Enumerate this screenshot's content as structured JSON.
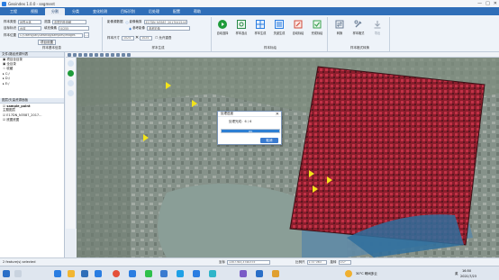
{
  "window": {
    "title": "Geoindex 1.0.0 - segment",
    "min": "—",
    "max": "□",
    "close": "✕"
  },
  "menu": {
    "tabs": [
      "工程",
      "视图",
      "分割",
      "分类",
      "变化检测",
      "目标识别",
      "后处理",
      "配置",
      "帮助"
    ],
    "active_index": 2
  },
  "ribbon": {
    "params": {
      "sample_type_label": "样本类型",
      "sample_type_value": "地表水体",
      "target_label": "目标标识",
      "target_value": "水体",
      "sample_pos_label": "样本位置",
      "sample_pos_value": "C:/Users/pan/Desktop/samples/images",
      "range_label": "范围",
      "range_value": "金属阳极电解",
      "fill_label": "填充像素",
      "fill_value": "0/255",
      "group_label": "样本基本信息",
      "project_btn": "项目设置"
    },
    "gen": {
      "image_label": "影像源数据",
      "radio1": "影像裁剪",
      "radio1_value": "E17DN_N3587_20170415.tif",
      "radio2": "参考影像",
      "radio2_value": "参考影像",
      "size_label": "样本尺寸",
      "size_w": "1024",
      "size_h": "1024",
      "cross": "✕",
      "check_label": "允许重叠",
      "group_label": "样本生成"
    },
    "buttons": [
      {
        "label": "自动选择",
        "color": "#1e9b3a",
        "glyph": "▶"
      },
      {
        "label": "样本选点",
        "color": "#2a8a4a",
        "glyph": "⌖"
      },
      {
        "label": "样本生成",
        "color": "#2a7de1",
        "glyph": "▦"
      },
      {
        "label": "关键生成",
        "color": "#2a7de1",
        "glyph": "▤"
      },
      {
        "label": "自动标绘",
        "color": "#d24b3a",
        "glyph": "✎"
      },
      {
        "label": "完成标绘",
        "color": "#3aa050",
        "glyph": "✔"
      },
      {
        "label": "转换",
        "color": "#6b7e96",
        "glyph": "⇄"
      },
      {
        "label": "样本格式",
        "color": "#6b7e96",
        "glyph": "⚒"
      },
      {
        "label": "导出",
        "color": "#9aa5b3",
        "glyph": "⇩"
      }
    ],
    "group3_label": "样本标绘",
    "group4_label": "样本格式转换"
  },
  "left_panel": {
    "header1": "文件/路径资源列表",
    "tree1": [
      "▣ 项目全目录",
      "▣ 全目录",
      "☆ 收藏",
      "▸ C:/",
      "▸ D:/",
      "▸ E:/"
    ],
    "header2": "图层/矢量资源面板",
    "tree2": [
      "☑ sample_point",
      "   主题图层",
      "☑ E17DN_N3587_2017...",
      "☑ 底图底图"
    ]
  },
  "dialog": {
    "title": "处理进度",
    "text": "处理完成：6 / 6",
    "progress": 1.0,
    "progress_text": "OK",
    "close": "✕",
    "cancel": "取消"
  },
  "status": {
    "left": "2 feature(s) selected",
    "coord_label": "坐标",
    "coord_value": "1307783,3740375",
    "scale_label": "比例尺",
    "scale_value": "1:37 063",
    "rot_label": "旋转",
    "rot_value": "0.0°"
  },
  "taskbar": {
    "weather": "30°C 晴间多云",
    "time": "16:50",
    "date": "2021/7/23",
    "lang": "英"
  }
}
